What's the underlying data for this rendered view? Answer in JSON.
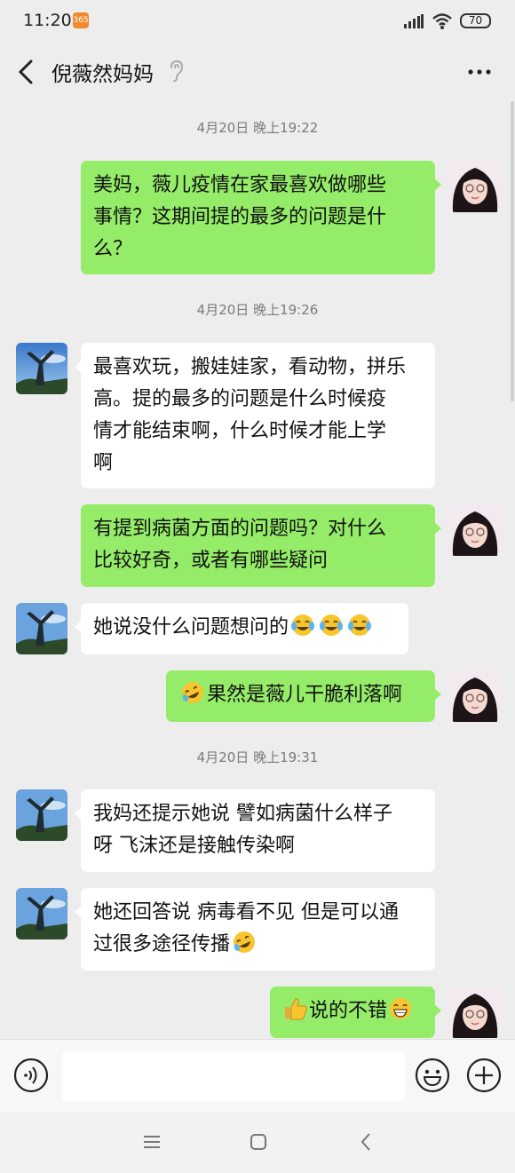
{
  "status_bar": {
    "time": "11:20",
    "app_badge": "365",
    "battery": "70"
  },
  "header": {
    "back_icon": "back-chevron-icon",
    "title": "倪薇然妈妈",
    "earpiece_icon": "earpiece-icon",
    "more_icon": "more-dots-icon"
  },
  "messages": [
    {
      "kind": "timestamp",
      "text": "4月20日 晚上19:22"
    },
    {
      "kind": "sent",
      "lines": [
        "美妈，薇儿疫情在家最喜欢做哪些",
        "事情？这期间提的最多的问题是什",
        "么？"
      ]
    },
    {
      "kind": "timestamp",
      "text": "4月20日 晚上19:26"
    },
    {
      "kind": "received",
      "lines": [
        "最喜欢玩，搬娃娃家，看动物，拼乐",
        "高。提的最多的问题是什么时候疫",
        "情才能结束啊，什么时候才能上学",
        "啊"
      ]
    },
    {
      "kind": "sent",
      "lines": [
        "有提到病菌方面的问题吗？对什么",
        "比较好奇，或者有哪些疑问"
      ]
    },
    {
      "kind": "received",
      "text": "她说没什么问题想问的",
      "emojis": [
        "tears-of-joy",
        "tears-of-joy",
        "tears-of-joy"
      ]
    },
    {
      "kind": "sent",
      "text": "果然是薇儿干脆利落啊",
      "emoji_before": "rolling-laughing"
    },
    {
      "kind": "timestamp",
      "text": "4月20日 晚上19:31"
    },
    {
      "kind": "received",
      "lines": [
        "我妈还提示她说 譬如病菌什么样子",
        "呀 飞沫还是接触传染啊"
      ]
    },
    {
      "kind": "received",
      "lines": [
        "她还回答说 病毒看不见 但是可以通",
        "过很多途径传播"
      ],
      "emoji_after": "rolling-laughing"
    },
    {
      "kind": "sent",
      "text": "说的不错",
      "emoji_before": "thumbs-up",
      "emoji_after": "grinning"
    }
  ],
  "input_bar": {
    "voice_icon": "voice-icon",
    "text_value": "",
    "emoji_icon": "emoji-icon",
    "plus_icon": "plus-icon"
  },
  "system_nav": {
    "menu_icon": "menu-icon",
    "home_icon": "home-icon",
    "back_icon": "back-icon"
  },
  "colors": {
    "background": "#ededed",
    "sent_bubble": "#95ec69",
    "received_bubble": "#ffffff",
    "timestamp": "#7b7b7b"
  }
}
